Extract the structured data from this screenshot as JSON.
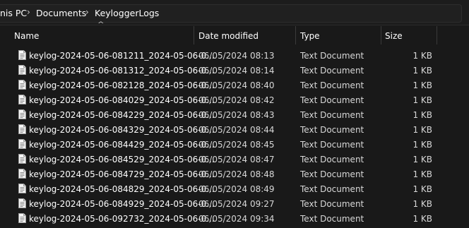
{
  "breadcrumb": {
    "items": [
      "nis PC",
      "Documents",
      "KeyloggerLogs"
    ],
    "separator": "›"
  },
  "columns": {
    "name": "Name",
    "date_modified": "Date modified",
    "type": "Type",
    "size": "Size"
  },
  "sort_indicator": "^",
  "files": [
    {
      "name": "keylog-2024-05-06-081211_2024-05-06-0...",
      "date": "06/05/2024 08:13",
      "type": "Text Document",
      "size": "1 KB"
    },
    {
      "name": "keylog-2024-05-06-081312_2024-05-06-0...",
      "date": "06/05/2024 08:14",
      "type": "Text Document",
      "size": "1 KB"
    },
    {
      "name": "keylog-2024-05-06-082128_2024-05-06-0...",
      "date": "06/05/2024 08:40",
      "type": "Text Document",
      "size": "1 KB"
    },
    {
      "name": "keylog-2024-05-06-084029_2024-05-06-0...",
      "date": "06/05/2024 08:42",
      "type": "Text Document",
      "size": "1 KB"
    },
    {
      "name": "keylog-2024-05-06-084229_2024-05-06-0...",
      "date": "06/05/2024 08:43",
      "type": "Text Document",
      "size": "1 KB"
    },
    {
      "name": "keylog-2024-05-06-084329_2024-05-06-0...",
      "date": "06/05/2024 08:44",
      "type": "Text Document",
      "size": "1 KB"
    },
    {
      "name": "keylog-2024-05-06-084429_2024-05-06-0...",
      "date": "06/05/2024 08:45",
      "type": "Text Document",
      "size": "1 KB"
    },
    {
      "name": "keylog-2024-05-06-084529_2024-05-06-0...",
      "date": "06/05/2024 08:47",
      "type": "Text Document",
      "size": "1 KB"
    },
    {
      "name": "keylog-2024-05-06-084729_2024-05-06-0...",
      "date": "06/05/2024 08:48",
      "type": "Text Document",
      "size": "1 KB"
    },
    {
      "name": "keylog-2024-05-06-084829_2024-05-06-0...",
      "date": "06/05/2024 08:49",
      "type": "Text Document",
      "size": "1 KB"
    },
    {
      "name": "keylog-2024-05-06-084929_2024-05-06-0...",
      "date": "06/05/2024 09:27",
      "type": "Text Document",
      "size": "1 KB"
    },
    {
      "name": "keylog-2024-05-06-092732_2024-05-06-0...",
      "date": "06/05/2024 09:34",
      "type": "Text Document",
      "size": "1 KB"
    }
  ],
  "icons": {
    "file": "text-document-icon",
    "separator": "chevron-right-icon"
  },
  "colors": {
    "background": "#191919",
    "text": "#ffffff",
    "divider": "#3a3a3a"
  }
}
